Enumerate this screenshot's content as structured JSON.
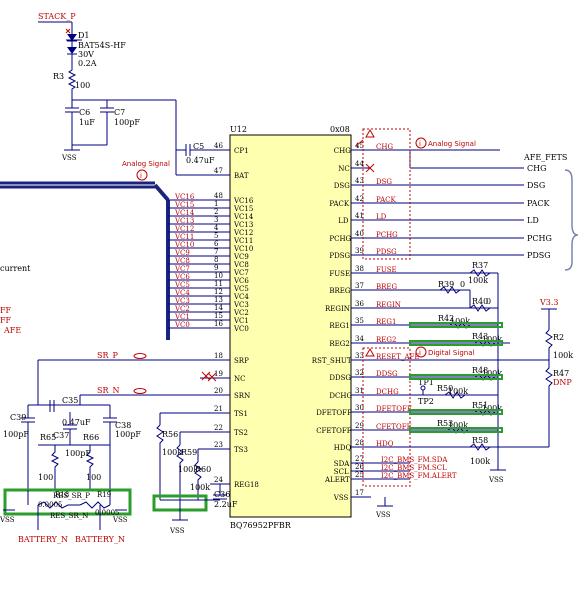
{
  "power": {
    "stack_p": "STACK_P",
    "d1_ref": "D1",
    "d1_part": "BAT54S-HF",
    "d1_v": "30V",
    "d1_i": "0.2A",
    "r3_ref": "R3",
    "r3_val": "100",
    "c6_ref": "C6",
    "c6_val": "1uF",
    "c7_ref": "C7",
    "c7_val": "100pF",
    "c5_ref": "C5",
    "c5_val": "0.47uF",
    "vss": "VSS"
  },
  "ic": {
    "ref": "U12",
    "part": "BQ76952PFBR",
    "addr": "0x08",
    "left_pins": [
      {
        "name": "CP1",
        "num": "46"
      },
      {
        "name": "BAT",
        "num": "47"
      },
      {
        "name": "VC16",
        "num": "48"
      },
      {
        "name": "VC15",
        "num": "1"
      },
      {
        "name": "VC14",
        "num": "2"
      },
      {
        "name": "VC13",
        "num": "3"
      },
      {
        "name": "VC12",
        "num": "4"
      },
      {
        "name": "VC11",
        "num": "5"
      },
      {
        "name": "VC10",
        "num": "6"
      },
      {
        "name": "VC9",
        "num": "7"
      },
      {
        "name": "VC8",
        "num": "8"
      },
      {
        "name": "VC7",
        "num": "9"
      },
      {
        "name": "VC6",
        "num": "10"
      },
      {
        "name": "VC5",
        "num": "11"
      },
      {
        "name": "VC4",
        "num": "12"
      },
      {
        "name": "VC3",
        "num": "13"
      },
      {
        "name": "VC2",
        "num": "14"
      },
      {
        "name": "VC1",
        "num": "15"
      },
      {
        "name": "VC0",
        "num": "16"
      },
      {
        "name": "SRP",
        "num": "18"
      },
      {
        "name": "NC",
        "num": "19"
      },
      {
        "name": "SRN",
        "num": "20"
      },
      {
        "name": "TS1",
        "num": "21"
      },
      {
        "name": "TS2",
        "num": "22"
      },
      {
        "name": "TS3",
        "num": "23"
      },
      {
        "name": "REG18",
        "num": "24"
      }
    ],
    "right_pins": [
      {
        "name": "CHG",
        "num": "45"
      },
      {
        "name": "NC",
        "num": "44"
      },
      {
        "name": "DSG",
        "num": "43"
      },
      {
        "name": "PACK",
        "num": "42"
      },
      {
        "name": "LD",
        "num": "41"
      },
      {
        "name": "PCHG",
        "num": "40"
      },
      {
        "name": "PDSG",
        "num": "39"
      },
      {
        "name": "FUSE",
        "num": "38"
      },
      {
        "name": "BREG",
        "num": "37"
      },
      {
        "name": "REGIN",
        "num": "36"
      },
      {
        "name": "REG1",
        "num": "35"
      },
      {
        "name": "REG2",
        "num": "34"
      },
      {
        "name": "RST_SHUT",
        "num": "33"
      },
      {
        "name": "DDSG",
        "num": "32"
      },
      {
        "name": "DCHG",
        "num": "31"
      },
      {
        "name": "DFETOFF",
        "num": "30"
      },
      {
        "name": "CFETOFF",
        "num": "29"
      },
      {
        "name": "HDQ",
        "num": "28"
      },
      {
        "name": "SDA",
        "num": "27"
      },
      {
        "name": "SCL",
        "num": "26"
      },
      {
        "name": "ALERT",
        "num": "25"
      },
      {
        "name": "VSS",
        "num": "17"
      }
    ]
  },
  "vc_nets": [
    "VC16",
    "VC15",
    "VC14",
    "VC13",
    "VC12",
    "VC11",
    "VC10",
    "VC9",
    "VC8",
    "VC7",
    "VC6",
    "VC5",
    "VC4",
    "VC3",
    "VC2",
    "VC1",
    "VC0"
  ],
  "right_nets": [
    "CHG",
    "DSG",
    "PACK",
    "LD",
    "PCHG",
    "PDSG",
    "FUSE",
    "BREG",
    "REGIN",
    "REG1",
    "REG2",
    "RESET_AFE",
    "DDSG",
    "DCHG",
    "DFETOFF",
    "CFETOFF",
    "HDQ",
    "I2C_BMS_FM.SDA",
    "I2C_BMS_FM.SCL",
    "I2C_BMS_FM.ALERT"
  ],
  "afe_fets": {
    "label": "AFE_FETS",
    "ports": [
      "CHG",
      "DSG",
      "PACK",
      "LD",
      "PCHG",
      "PDSG"
    ]
  },
  "annotations": {
    "analog_left": "Analog Signal",
    "analog_right": "Analog Signal",
    "digital": "Digital Signal",
    "circle_mark": "i"
  },
  "right_parts": {
    "r37": "R37",
    "r37_val": "100k",
    "r39": "R39",
    "r39_val": "0",
    "r40": "R40",
    "r40_val": "0",
    "r42": "R42",
    "r42_val": "100k",
    "r43": "R43",
    "r43_val": "100k",
    "r48": "R48",
    "r48_val": "100k",
    "r50": "R50",
    "r50_val": "100k",
    "r51": "R51",
    "r51_val": "100k",
    "r53": "R53",
    "r53_val": "100k",
    "r58": "R58",
    "r58_val": "100k",
    "tp1": "TP1",
    "tp2": "TP2",
    "v33": "V3.3",
    "r2": "R2",
    "r2_val": "100k",
    "r47": "R47",
    "r47_val": "DNP"
  },
  "left_parts": {
    "sr_p": "SR_P",
    "sr_n": "SR_N",
    "c39": "C39",
    "c39_val": "100pF",
    "c35": "C35",
    "c35_val": "0.47uF",
    "c37": "C37",
    "c37_val": "100pF",
    "c38": "C38",
    "c38_val": "100pF",
    "r65": "R65",
    "r65_val": "100",
    "r66": "R66",
    "r66_val": "100",
    "r18": "R18",
    "r18_val": "0.0005",
    "r19": "R19",
    "r19_val": "0.0005",
    "res_sr_p": "RES_SR_P",
    "res_sr_n": "RES_SR_N",
    "batt_n1": "BATTERY_N",
    "batt_n2": "BATTERY_N",
    "current": "current",
    "r56": "R56",
    "r56_val": "100k",
    "r59": "R59",
    "r59_val": "100k",
    "r60": "R60",
    "r60_val": "100k",
    "c36": "C36",
    "c36_val": "2.2uF"
  },
  "edge_text": [
    "FF",
    "FF",
    "AFE"
  ],
  "colors": {
    "wire": "#000080",
    "label": "#c00000",
    "body": "#ffffb0",
    "green": "#2a9d2a",
    "bus": "#1a237e"
  }
}
